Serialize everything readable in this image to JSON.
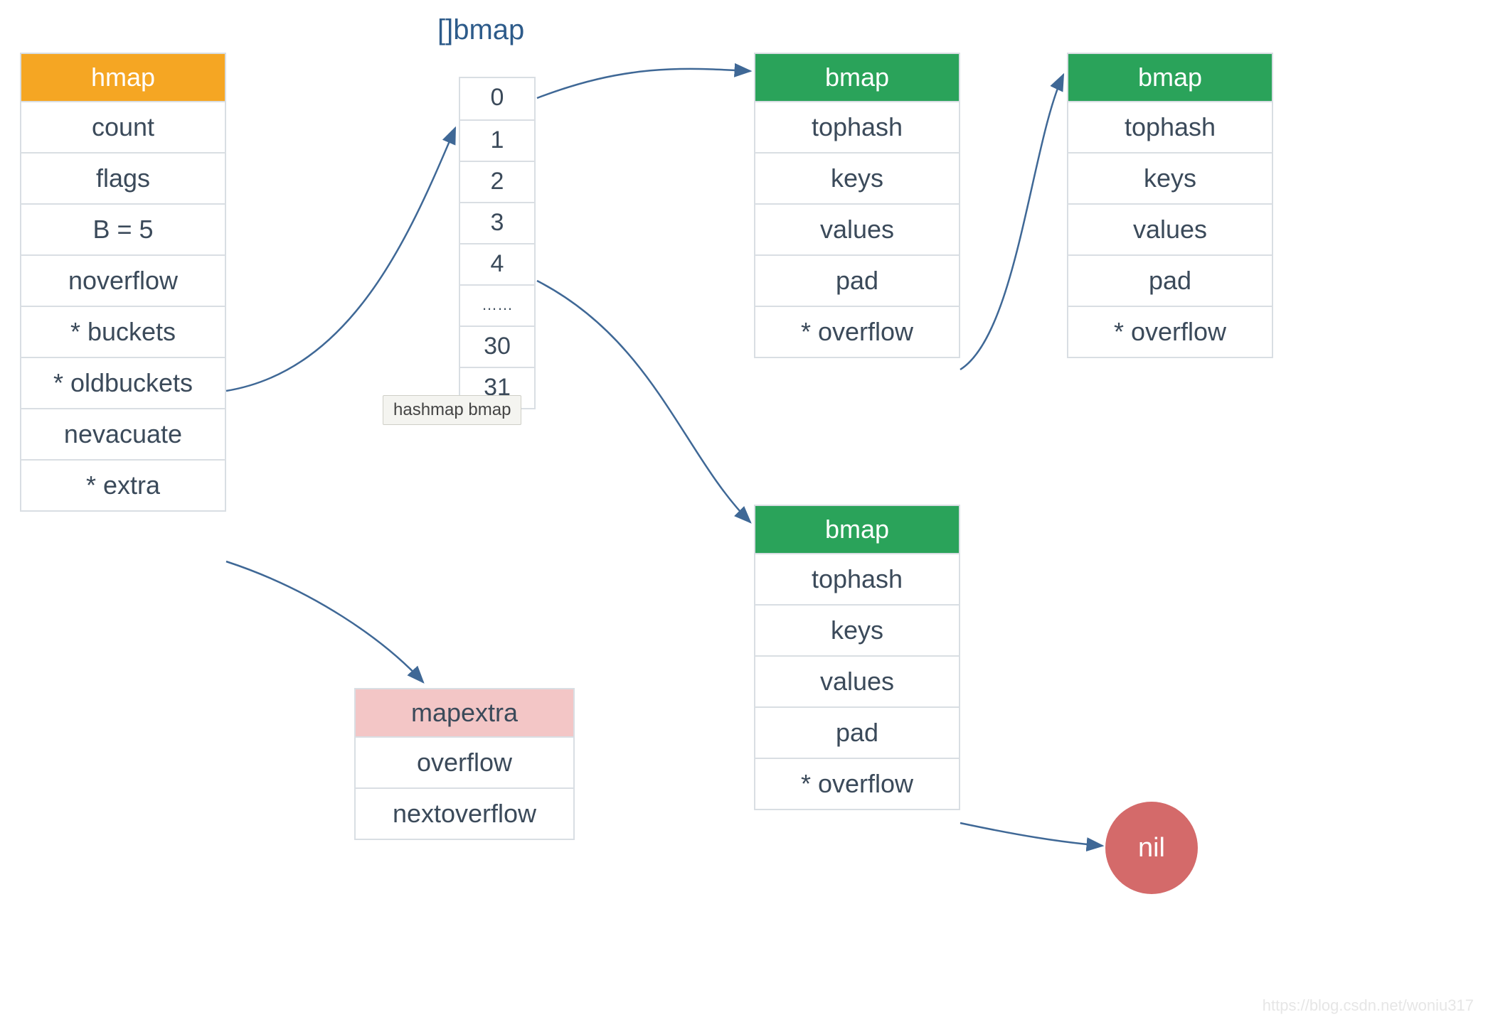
{
  "hmap": {
    "title": "hmap",
    "fields": [
      "count",
      "flags",
      "B = 5",
      "noverflow",
      "* buckets",
      "* oldbuckets",
      "nevacuate",
      "* extra"
    ]
  },
  "array": {
    "label": "[]bmap",
    "cells": [
      "0",
      "1",
      "2",
      "3",
      "4",
      "……",
      "30",
      "31"
    ]
  },
  "bmap1": {
    "title": "bmap",
    "fields": [
      "tophash",
      "keys",
      "values",
      "pad",
      "* overflow"
    ]
  },
  "bmap2": {
    "title": "bmap",
    "fields": [
      "tophash",
      "keys",
      "values",
      "pad",
      "* overflow"
    ]
  },
  "bmap3": {
    "title": "bmap",
    "fields": [
      "tophash",
      "keys",
      "values",
      "pad",
      "* overflow"
    ]
  },
  "mapextra": {
    "title": "mapextra",
    "fields": [
      "overflow",
      "nextoverflow"
    ]
  },
  "nil_label": "nil",
  "tooltip": "hashmap bmap",
  "watermark": "https://blog.csdn.net/woniu317"
}
